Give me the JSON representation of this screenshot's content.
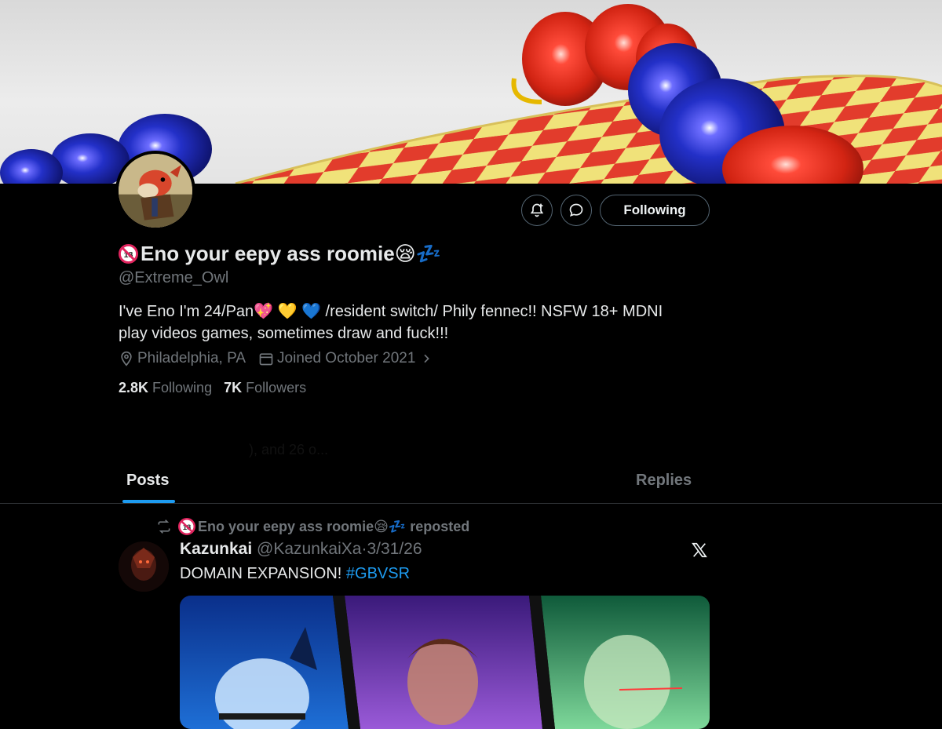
{
  "profile": {
    "name": "Eno your eepy ass roomie😪💤",
    "handle": "@Extreme_Owl",
    "bio_line1": "I've Eno I'm 24/Pan💖 💛 💙 /resident switch/ Phily fennec!! NSFW 18+ MDNI",
    "bio_line2": "play videos games, sometimes draw and fuck!!!",
    "location": "Philadelphia, PA",
    "joined": "Joined October 2021",
    "following_count": "2.8K",
    "following_label": "Following",
    "followers_count": "7K",
    "followers_label": "Followers",
    "followed_by_faded": "), and 26 o..."
  },
  "actions": {
    "follow_label": "Following",
    "notify_icon": "bell-plus-icon",
    "message_icon": "message-icon"
  },
  "tabs": [
    {
      "label": "Posts",
      "active": true
    },
    {
      "label": "Replies",
      "active": false
    }
  ],
  "post": {
    "repost_label": "Eno your eepy ass roomie😪💤 reposted",
    "author": "Kazunkai",
    "handle": "@KazunkaiXa",
    "date": "3/31/26",
    "text": "DOMAIN EXPANSION!",
    "hashtag": "#GBVSR"
  },
  "colors": {
    "accent": "#1d9bf0",
    "muted": "#71767b",
    "border": "#2f3336"
  }
}
